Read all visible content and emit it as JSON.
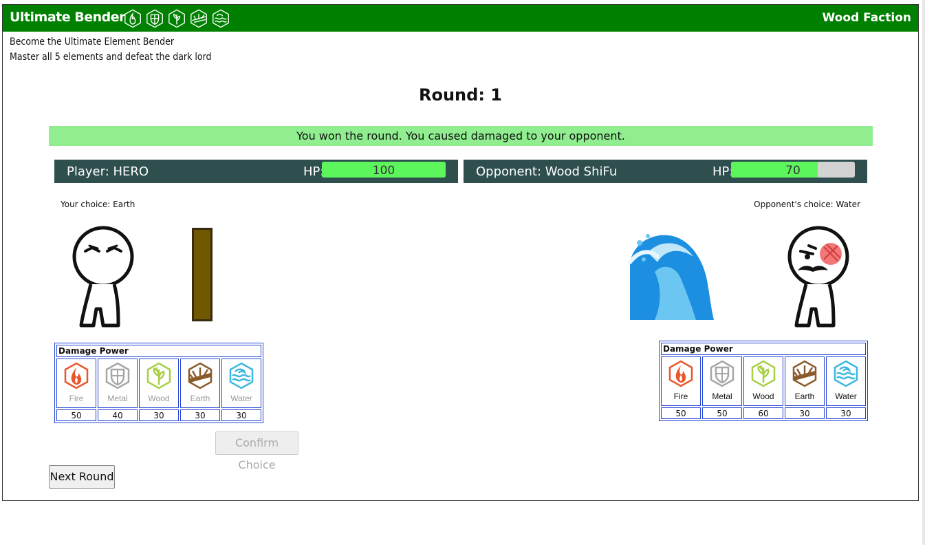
{
  "header": {
    "title": "Ultimate Bender",
    "faction": "Wood Faction",
    "element_icons": [
      "fire-icon",
      "metal-icon",
      "wood-icon",
      "earth-icon",
      "water-icon"
    ]
  },
  "intro": {
    "line1": "Become the Ultimate Element Bender",
    "line2": "Master all 5 elements and defeat the dark lord"
  },
  "round": {
    "label": "Round: 1"
  },
  "message": "You won the round. You caused damaged to your opponent.",
  "player": {
    "name": "Player: HERO",
    "hp_label": "HP:",
    "hp": "100",
    "hp_fraction": 1.0,
    "choice": "Your choice: Earth"
  },
  "opponent": {
    "name": "Opponent: Wood ShiFu",
    "hp_label": "HP:",
    "hp": "70",
    "hp_fraction": 0.7,
    "choice": "Opponent's choice: Water"
  },
  "damage_power": {
    "title": "Damage Power",
    "elements": [
      "Fire",
      "Metal",
      "Wood",
      "Earth",
      "Water"
    ],
    "colors": {
      "Fire": "#e8572a",
      "Metal": "#a6a6a6",
      "Wood": "#a8cf45",
      "Earth": "#8b5a2b",
      "Water": "#3cb8e0"
    },
    "player_values": [
      "50",
      "40",
      "30",
      "30",
      "30"
    ],
    "opponent_values": [
      "50",
      "50",
      "60",
      "30",
      "30"
    ]
  },
  "buttons": {
    "confirm": "Confirm Choice",
    "next": "Next Round"
  },
  "colors": {
    "header_bg": "#008000",
    "banner_bg": "#90ee90",
    "bar_bg": "#2f4f4f",
    "hp_fill": "#5cf55c"
  }
}
